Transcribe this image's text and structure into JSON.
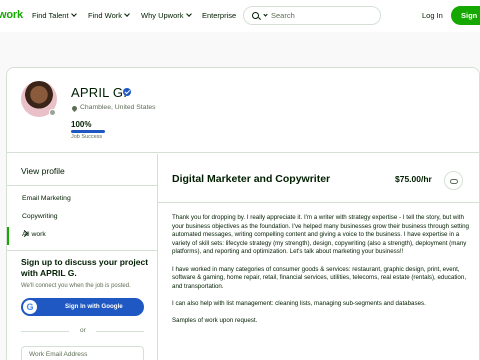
{
  "nav": {
    "brand": "work",
    "items": [
      {
        "label": "Find Talent"
      },
      {
        "label": "Find Work"
      },
      {
        "label": "Why Upwork"
      },
      {
        "label": "Enterprise"
      }
    ],
    "search_placeholder": "Search",
    "login": "Log In",
    "signup": "Sign"
  },
  "profile": {
    "name": "APRIL G.",
    "location": "Chamblee, United States",
    "job_success_pct": "100%",
    "job_success_value": 1.0,
    "job_success_label": "Job Success"
  },
  "sidebar": {
    "view_profile": "View profile",
    "items": [
      {
        "label": "Email Marketing"
      },
      {
        "label": "Copywriting"
      },
      {
        "label": "All work"
      }
    ],
    "signup_heading": "Sign up to discuss your project with APRIL G.",
    "signup_sub": "We'll connect you when the job is posted.",
    "google_icon_letter": "G",
    "google_button": "Sign In with Google",
    "or": "or",
    "email_placeholder": "Work Email Address"
  },
  "main": {
    "title": "Digital Marketer and Copywriter",
    "rate": "$75.00/hr",
    "bio": [
      "Thank you for dropping by. I really appreciate it. I'm a writer with strategy expertise - I tell the story, but with your business objectives as the foundation. I've helped many businesses grow their business through setting automated messages, writing compelling content and giving a voice to the business. I have expertise in a variety of skill sets: lifecycle strategy (my strength), design, copywriting (also a strength), deployment (many platforms), and reporting and optimization. Let's talk about marketing your business!!",
      "I have worked in many categories of consumer goods & services: restaurant, graphic design, print, event, software & gaming, home repair, retail, financial services, utilities, telecoms, real estate (rentals), education, and transportation.",
      "I can also help with list management: cleaning lists, managing sub-segments and databases.",
      "Samples of work upon request."
    ]
  },
  "colors": {
    "brand_green": "#14a800",
    "verified_blue": "#1f57c3"
  }
}
